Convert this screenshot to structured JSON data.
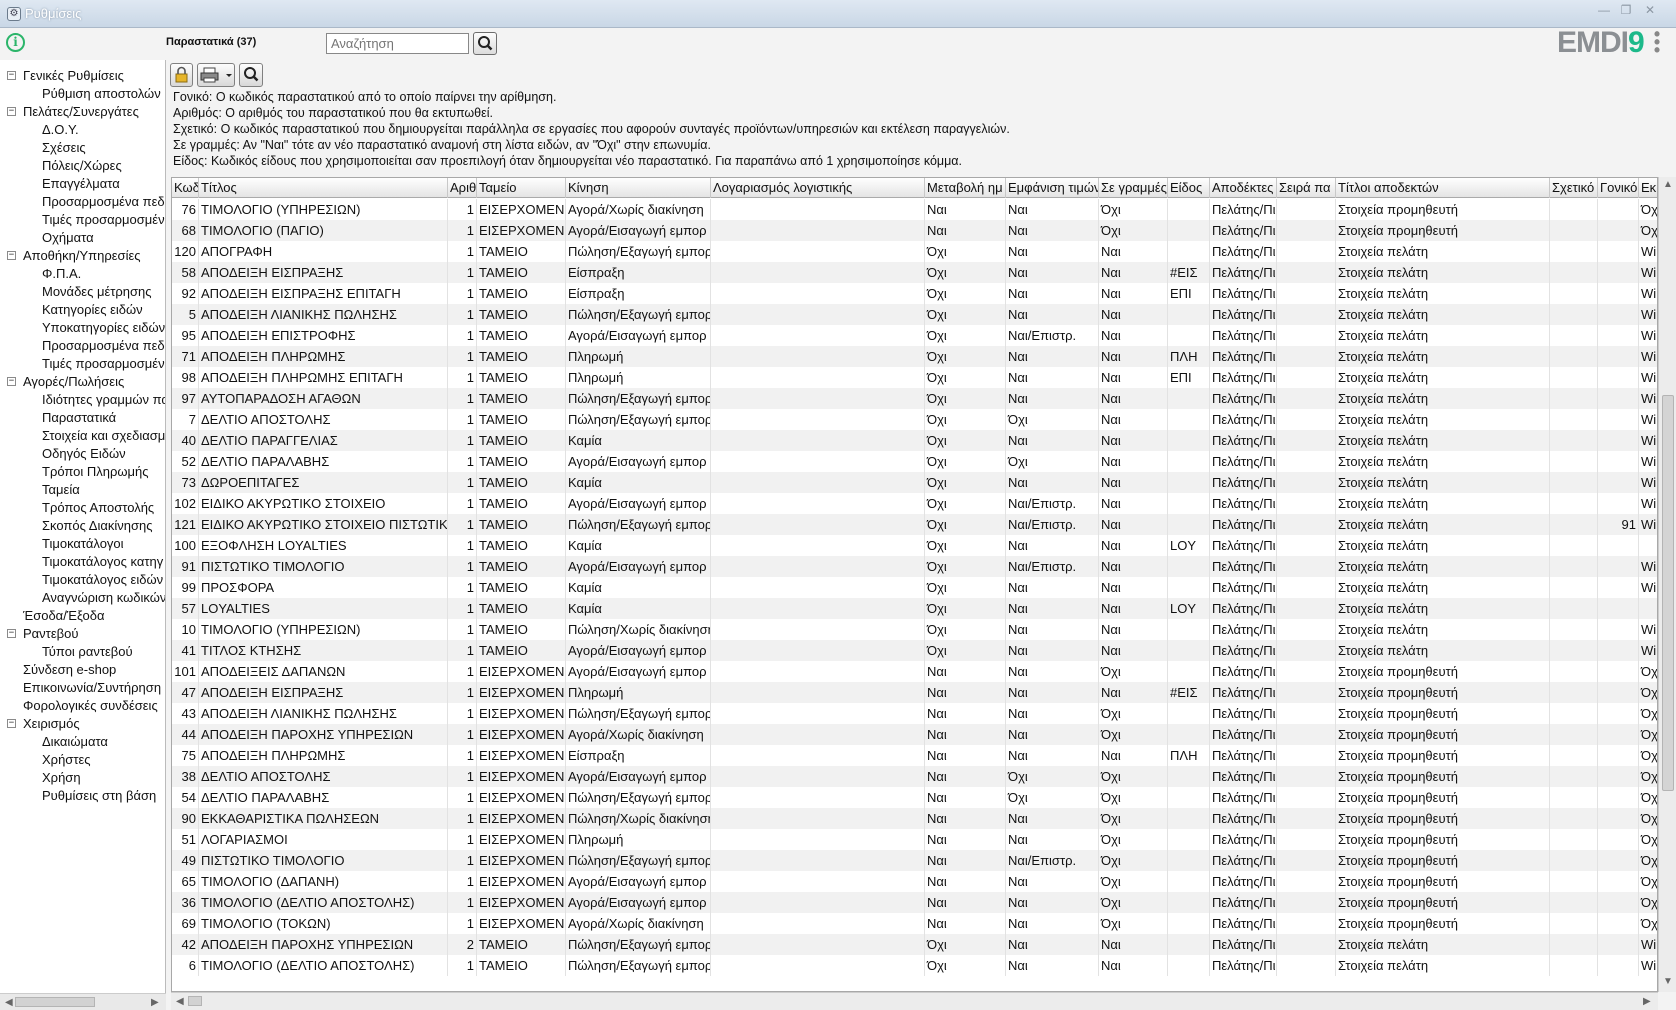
{
  "window": {
    "title": "Ρυθμίσεις"
  },
  "header": {
    "page_title": "Παραστατικά (37)",
    "search_placeholder": "Αναζήτηση",
    "logo_text": "EMDI",
    "logo_accent": "9"
  },
  "sidebar": {
    "items": [
      {
        "label": "Γενικές Ρυθμίσεις",
        "level": 0,
        "toggle": "−"
      },
      {
        "label": "Ρύθμιση αποστολών",
        "level": 1
      },
      {
        "label": "Πελάτες/Συνεργάτες",
        "level": 0,
        "toggle": "−"
      },
      {
        "label": "Δ.Ο.Υ.",
        "level": 1
      },
      {
        "label": "Σχέσεις",
        "level": 1
      },
      {
        "label": "Πόλεις/Χώρες",
        "level": 1
      },
      {
        "label": "Επαγγέλματα",
        "level": 1
      },
      {
        "label": "Προσαρμοσμένα πεδί",
        "level": 1
      },
      {
        "label": "Τιμές προσαρμοσμένω",
        "level": 1
      },
      {
        "label": "Οχήματα",
        "level": 1
      },
      {
        "label": "Αποθήκη/Υπηρεσίες",
        "level": 0,
        "toggle": "−"
      },
      {
        "label": "Φ.Π.Α.",
        "level": 1
      },
      {
        "label": "Μονάδες μέτρησης",
        "level": 1
      },
      {
        "label": "Κατηγορίες ειδών",
        "level": 1
      },
      {
        "label": "Υποκατηγορίες ειδών",
        "level": 1
      },
      {
        "label": "Προσαρμοσμένα πεδί",
        "level": 1
      },
      {
        "label": "Τιμές προσαρμοσμένι",
        "level": 1
      },
      {
        "label": "Αγορές/Πωλήσεις",
        "level": 0,
        "toggle": "−"
      },
      {
        "label": "Ιδιότητες γραμμών πα",
        "level": 1
      },
      {
        "label": "Παραστατικά",
        "level": 1
      },
      {
        "label": "Στοιχεία και σχεδιασμ",
        "level": 1
      },
      {
        "label": "Οδηγός Ειδών",
        "level": 1
      },
      {
        "label": "Τρόποι Πληρωμής",
        "level": 1
      },
      {
        "label": "Ταμεία",
        "level": 1
      },
      {
        "label": "Τρόπος Αποστολής",
        "level": 1
      },
      {
        "label": "Σκοπός Διακίνησης",
        "level": 1
      },
      {
        "label": "Τιμοκατάλογοι",
        "level": 1
      },
      {
        "label": "Τιμοκατάλογος κατηγ",
        "level": 1
      },
      {
        "label": "Τιμοκατάλογος ειδών",
        "level": 1
      },
      {
        "label": "Αναγνώριση κωδικών",
        "level": 1
      },
      {
        "label": "Έσοδα/Έξοδα",
        "level": 0
      },
      {
        "label": "Ραντεβού",
        "level": 0,
        "toggle": "−"
      },
      {
        "label": "Τύποι ραντεβού",
        "level": 1
      },
      {
        "label": "Σύνδεση e-shop",
        "level": 0
      },
      {
        "label": "Επικοινωνία/Συντήρηση",
        "level": 0
      },
      {
        "label": "Φορολογικές συνδέσεις",
        "level": 0
      },
      {
        "label": "Χειρισμός",
        "level": 0,
        "toggle": "−"
      },
      {
        "label": "Δικαιώματα",
        "level": 1
      },
      {
        "label": "Χρήστες",
        "level": 1
      },
      {
        "label": "Χρήση",
        "level": 1
      },
      {
        "label": "Ρυθμίσεις στη βάση",
        "level": 1
      }
    ]
  },
  "description": [
    "Γονικό: Ο κωδικός παραστατικού από το οποίο παίρνει την αρίθμηση.",
    "Αριθμός: Ο αριθμός του παραστατικού που θα εκτυπωθεί.",
    "Σχετικό: Ο κωδικός παραστατικού που δημιουργείται παράλληλα σε εργασίες που αφορούν συνταγές προϊόντων/υπηρεσιών και εκτέλεση παραγγελιών.",
    "Σε γραμμές: Αν \"Ναι\" τότε αν νέο παραστατικό αναμονή στη λίστα ειδών, αν \"Όχι\" στην επωνυμία.",
    "Είδος: Κωδικός είδους που χρησιμοποιείται σαν προεπιλογή όταν δημιουργείται νέο παραστατικό. Για παραπάνω από 1 χρησιμοποίησε κόμμα."
  ],
  "table": {
    "columns": [
      "Κωδ",
      "Τίτλος",
      "Αριθ",
      "Ταμείο",
      "Κίνηση",
      "Λογαριασμός λογιστικής",
      "Μεταβολή ημ",
      "Εμφάνιση τιμών",
      "Σε γραμμές",
      "Είδος",
      "Αποδέκτες",
      "Σειρά πα",
      "Τίτλοι αποδεκτών",
      "Σχετικό",
      "Γονικό",
      "Εκ"
    ],
    "rows": [
      [
        "76",
        "ΤΙΜΟΛΟΓΙΟ (ΥΠΗΡΕΣΙΩΝ)",
        "1",
        "ΕΙΣΕΡΧΟΜΕΝ.",
        "Αγορά/Χωρίς διακίνηση",
        "",
        "Ναι",
        "Ναι",
        "Όχι",
        "",
        "Πελάτης/Πι",
        "",
        "Στοιχεία προμηθευτή",
        "",
        "",
        "Όχ"
      ],
      [
        "68",
        "ΤΙΜΟΛΟΓΙΟ (ΠΑΓΙΟ)",
        "1",
        "ΕΙΣΕΡΧΟΜΕΝ.",
        "Αγορά/Εισαγωγή εμπορ",
        "",
        "Ναι",
        "Ναι",
        "Όχι",
        "",
        "Πελάτης/Πι",
        "",
        "Στοιχεία προμηθευτή",
        "",
        "",
        "Όχ"
      ],
      [
        "120",
        "ΑΠΟΓΡΑΦΗ",
        "1",
        "ΤΑΜΕΙΟ",
        "Πώληση/Εξαγωγή εμπορ",
        "",
        "Όχι",
        "Ναι",
        "Ναι",
        "",
        "Πελάτης/Πι",
        "",
        "Στοιχεία πελάτη",
        "",
        "",
        "Wi"
      ],
      [
        "58",
        "ΑΠΟΔΕΙΞΗ ΕΙΣΠΡΑΞΗΣ",
        "1",
        "ΤΑΜΕΙΟ",
        "Είσπραξη",
        "",
        "Όχι",
        "Ναι",
        "Ναι",
        "#ΕΙΣ",
        "Πελάτης/Πι",
        "",
        "Στοιχεία πελάτη",
        "",
        "",
        "Wi"
      ],
      [
        "92",
        "ΑΠΟΔΕΙΞΗ ΕΙΣΠΡΑΞΗΣ ΕΠΙΤΑΓΗ",
        "1",
        "ΤΑΜΕΙΟ",
        "Είσπραξη",
        "",
        "Όχι",
        "Ναι",
        "Ναι",
        "ΕΠΙ",
        "Πελάτης/Πι",
        "",
        "Στοιχεία πελάτη",
        "",
        "",
        "Wi"
      ],
      [
        "5",
        "ΑΠΟΔΕΙΞΗ ΛΙΑΝΙΚΗΣ ΠΩΛΗΣΗΣ",
        "1",
        "ΤΑΜΕΙΟ",
        "Πώληση/Εξαγωγή εμπορ",
        "",
        "Όχι",
        "Ναι",
        "Ναι",
        "",
        "Πελάτης/Πι",
        "",
        "Στοιχεία πελάτη",
        "",
        "",
        "Wi"
      ],
      [
        "95",
        "ΑΠΟΔΕΙΞΗ ΕΠΙΣΤΡΟΦΗΣ",
        "1",
        "ΤΑΜΕΙΟ",
        "Αγορά/Εισαγωγή εμπορ",
        "",
        "Όχι",
        "Ναι/Επιστρ.",
        "Ναι",
        "",
        "Πελάτης/Πι",
        "",
        "Στοιχεία πελάτη",
        "",
        "",
        "Wi"
      ],
      [
        "71",
        "ΑΠΟΔΕΙΞΗ ΠΛΗΡΩΜΗΣ",
        "1",
        "ΤΑΜΕΙΟ",
        "Πληρωμή",
        "",
        "Όχι",
        "Ναι",
        "Ναι",
        "ΠΛΗ",
        "Πελάτης/Πι",
        "",
        "Στοιχεία πελάτη",
        "",
        "",
        "Wi"
      ],
      [
        "98",
        "ΑΠΟΔΕΙΞΗ ΠΛΗΡΩΜΗΣ ΕΠΙΤΑΓΗ",
        "1",
        "ΤΑΜΕΙΟ",
        "Πληρωμή",
        "",
        "Όχι",
        "Ναι",
        "Ναι",
        "ΕΠΙ",
        "Πελάτης/Πι",
        "",
        "Στοιχεία πελάτη",
        "",
        "",
        "Wi"
      ],
      [
        "97",
        "ΑΥΤΟΠΑΡΑΔΟΣΗ ΑΓΑΘΩΝ",
        "1",
        "ΤΑΜΕΙΟ",
        "Πώληση/Εξαγωγή εμπορ",
        "",
        "Όχι",
        "Ναι",
        "Ναι",
        "",
        "Πελάτης/Πι",
        "",
        "Στοιχεία πελάτη",
        "",
        "",
        "Wi"
      ],
      [
        "7",
        "ΔΕΛΤΙΟ ΑΠΟΣΤΟΛΗΣ",
        "1",
        "ΤΑΜΕΙΟ",
        "Πώληση/Εξαγωγή εμπορ",
        "",
        "Όχι",
        "Όχι",
        "Ναι",
        "",
        "Πελάτης/Πι",
        "",
        "Στοιχεία πελάτη",
        "",
        "",
        "Wi"
      ],
      [
        "40",
        "ΔΕΛΤΙΟ ΠΑΡΑΓΓΕΛΙΑΣ",
        "1",
        "ΤΑΜΕΙΟ",
        "Καμία",
        "",
        "Όχι",
        "Ναι",
        "Ναι",
        "",
        "Πελάτης/Πι",
        "",
        "Στοιχεία πελάτη",
        "",
        "",
        "Wi"
      ],
      [
        "52",
        "ΔΕΛΤΙΟ ΠΑΡΑΛΑΒΗΣ",
        "1",
        "ΤΑΜΕΙΟ",
        "Αγορά/Εισαγωγή εμπορ",
        "",
        "Όχι",
        "Όχι",
        "Ναι",
        "",
        "Πελάτης/Πι",
        "",
        "Στοιχεία πελάτη",
        "",
        "",
        "Wi"
      ],
      [
        "73",
        "ΔΩΡΟΕΠΙΤΑΓΕΣ",
        "1",
        "ΤΑΜΕΙΟ",
        "Καμία",
        "",
        "Όχι",
        "Ναι",
        "Ναι",
        "",
        "Πελάτης/Πι",
        "",
        "Στοιχεία πελάτη",
        "",
        "",
        "Wi"
      ],
      [
        "102",
        "ΕΙΔΙΚΟ ΑΚΥΡΩΤΙΚΟ ΣΤΟΙΧΕΙΟ",
        "1",
        "ΤΑΜΕΙΟ",
        "Αγορά/Εισαγωγή εμπορ",
        "",
        "Όχι",
        "Ναι/Επιστρ.",
        "Ναι",
        "",
        "Πελάτης/Πι",
        "",
        "Στοιχεία πελάτη",
        "",
        "",
        "Wi"
      ],
      [
        "121",
        "ΕΙΔΙΚΟ ΑΚΥΡΩΤΙΚΟ ΣΤΟΙΧΕΙΟ ΠΙΣΤΩΤΙΚ",
        "1",
        "ΤΑΜΕΙΟ",
        "Πώληση/Εξαγωγή εμπορ",
        "",
        "Όχι",
        "Ναι/Επιστρ.",
        "Ναι",
        "",
        "Πελάτης/Πι",
        "",
        "Στοιχεία πελάτη",
        "",
        "91",
        "Wi"
      ],
      [
        "100",
        "ΕΞΟΦΛΗΣΗ LOYALTIES",
        "1",
        "ΤΑΜΕΙΟ",
        "Καμία",
        "",
        "Όχι",
        "Ναι",
        "Ναι",
        "LOY",
        "Πελάτης/Πι",
        "",
        "Στοιχεία πελάτη",
        "",
        "",
        ""
      ],
      [
        "91",
        "ΠΙΣΤΩΤΙΚΟ ΤΙΜΟΛΟΓΙΟ",
        "1",
        "ΤΑΜΕΙΟ",
        "Αγορά/Εισαγωγή εμπορ",
        "",
        "Όχι",
        "Ναι/Επιστρ.",
        "Ναι",
        "",
        "Πελάτης/Πι",
        "",
        "Στοιχεία πελάτη",
        "",
        "",
        "Wi"
      ],
      [
        "99",
        "ΠΡΟΣΦΟΡΑ",
        "1",
        "ΤΑΜΕΙΟ",
        "Καμία",
        "",
        "Όχι",
        "Ναι",
        "Ναι",
        "",
        "Πελάτης/Πι",
        "",
        "Στοιχεία πελάτη",
        "",
        "",
        "Wi"
      ],
      [
        "57",
        "LOYALTIES",
        "1",
        "ΤΑΜΕΙΟ",
        "Καμία",
        "",
        "Όχι",
        "Ναι",
        "Ναι",
        "LOY",
        "Πελάτης/Πι",
        "",
        "Στοιχεία πελάτη",
        "",
        "",
        ""
      ],
      [
        "10",
        "ΤΙΜΟΛΟΓΙΟ (ΥΠΗΡΕΣΙΩΝ)",
        "1",
        "ΤΑΜΕΙΟ",
        "Πώληση/Χωρίς διακίνηση",
        "",
        "Όχι",
        "Ναι",
        "Ναι",
        "",
        "Πελάτης/Πι",
        "",
        "Στοιχεία πελάτη",
        "",
        "",
        "Wi"
      ],
      [
        "41",
        "ΤΙΤΛΟΣ ΚΤΗΣΗΣ",
        "1",
        "ΤΑΜΕΙΟ",
        "Αγορά/Εισαγωγή εμπορ",
        "",
        "Όχι",
        "Ναι",
        "Ναι",
        "",
        "Πελάτης/Πι",
        "",
        "Στοιχεία πελάτη",
        "",
        "",
        "Wi"
      ],
      [
        "101",
        "ΑΠΟΔΕΙΞΕΙΣ ΔΑΠΑΝΩΝ",
        "1",
        "ΕΙΣΕΡΧΟΜΕΝ.",
        "Αγορά/Εισαγωγή εμπορ",
        "",
        "Ναι",
        "Ναι",
        "Όχι",
        "",
        "Πελάτης/Πι",
        "",
        "Στοιχεία προμηθευτή",
        "",
        "",
        "Όχ"
      ],
      [
        "47",
        "ΑΠΟΔΕΙΞΗ ΕΙΣΠΡΑΞΗΣ",
        "1",
        "ΕΙΣΕΡΧΟΜΕΝ.",
        "Πληρωμή",
        "",
        "Ναι",
        "Ναι",
        "Ναι",
        "#ΕΙΣ",
        "Πελάτης/Πι",
        "",
        "Στοιχεία προμηθευτή",
        "",
        "",
        "Όχ"
      ],
      [
        "43",
        "ΑΠΟΔΕΙΞΗ ΛΙΑΝΙΚΗΣ ΠΩΛΗΣΗΣ",
        "1",
        "ΕΙΣΕΡΧΟΜΕΝ.",
        "Πώληση/Εξαγωγή εμπορ",
        "",
        "Ναι",
        "Ναι",
        "Όχι",
        "",
        "Πελάτης/Πι",
        "",
        "Στοιχεία προμηθευτή",
        "",
        "",
        "Όχ"
      ],
      [
        "44",
        "ΑΠΟΔΕΙΞΗ ΠΑΡΟΧΗΣ ΥΠΗΡΕΣΙΩΝ",
        "1",
        "ΕΙΣΕΡΧΟΜΕΝ.",
        "Αγορά/Χωρίς διακίνηση",
        "",
        "Ναι",
        "Ναι",
        "Όχι",
        "",
        "Πελάτης/Πι",
        "",
        "Στοιχεία προμηθευτή",
        "",
        "",
        "Όχ"
      ],
      [
        "75",
        "ΑΠΟΔΕΙΞΗ ΠΛΗΡΩΜΗΣ",
        "1",
        "ΕΙΣΕΡΧΟΜΕΝ.",
        "Είσπραξη",
        "",
        "Ναι",
        "Ναι",
        "Ναι",
        "ΠΛΗ",
        "Πελάτης/Πι",
        "",
        "Στοιχεία προμηθευτή",
        "",
        "",
        "Όχ"
      ],
      [
        "38",
        "ΔΕΛΤΙΟ ΑΠΟΣΤΟΛΗΣ",
        "1",
        "ΕΙΣΕΡΧΟΜΕΝ.",
        "Αγορά/Εισαγωγή εμπορ",
        "",
        "Ναι",
        "Όχι",
        "Όχι",
        "",
        "Πελάτης/Πι",
        "",
        "Στοιχεία προμηθευτή",
        "",
        "",
        "Όχ"
      ],
      [
        "54",
        "ΔΕΛΤΙΟ ΠΑΡΑΛΑΒΗΣ",
        "1",
        "ΕΙΣΕΡΧΟΜΕΝ.",
        "Πώληση/Εξαγωγή εμπορ",
        "",
        "Ναι",
        "Όχι",
        "Όχι",
        "",
        "Πελάτης/Πι",
        "",
        "Στοιχεία προμηθευτή",
        "",
        "",
        "Όχ"
      ],
      [
        "90",
        "ΕΚΚΑΘΑΡΙΣΤΙΚΑ ΠΩΛΗΣΕΩΝ",
        "1",
        "ΕΙΣΕΡΧΟΜΕΝ.",
        "Πώληση/Χωρίς διακίνηση",
        "",
        "Ναι",
        "Ναι",
        "Όχι",
        "",
        "Πελάτης/Πι",
        "",
        "Στοιχεία προμηθευτή",
        "",
        "",
        "Όχ"
      ],
      [
        "51",
        "ΛΟΓΑΡΙΑΣΜΟΙ",
        "1",
        "ΕΙΣΕΡΧΟΜΕΝ.",
        "Πληρωμή",
        "",
        "Ναι",
        "Ναι",
        "Όχι",
        "",
        "Πελάτης/Πι",
        "",
        "Στοιχεία προμηθευτή",
        "",
        "",
        "Όχ"
      ],
      [
        "49",
        "ΠΙΣΤΩΤΙΚΟ ΤΙΜΟΛΟΓΙΟ",
        "1",
        "ΕΙΣΕΡΧΟΜΕΝ.",
        "Πώληση/Εξαγωγή εμπορ",
        "",
        "Ναι",
        "Ναι/Επιστρ.",
        "Όχι",
        "",
        "Πελάτης/Πι",
        "",
        "Στοιχεία προμηθευτή",
        "",
        "",
        "Όχ"
      ],
      [
        "65",
        "ΤΙΜΟΛΟΓΙΟ (ΔΑΠΑΝΗ)",
        "1",
        "ΕΙΣΕΡΧΟΜΕΝ.",
        "Αγορά/Εισαγωγή εμπορ",
        "",
        "Ναι",
        "Ναι",
        "Όχι",
        "",
        "Πελάτης/Πι",
        "",
        "Στοιχεία προμηθευτή",
        "",
        "",
        "Όχ"
      ],
      [
        "36",
        "ΤΙΜΟΛΟΓΙΟ (ΔΕΛΤΙΟ ΑΠΟΣΤΟΛΗΣ)",
        "1",
        "ΕΙΣΕΡΧΟΜΕΝ.",
        "Αγορά/Εισαγωγή εμπορ",
        "",
        "Ναι",
        "Ναι",
        "Όχι",
        "",
        "Πελάτης/Πι",
        "",
        "Στοιχεία προμηθευτή",
        "",
        "",
        "Όχ"
      ],
      [
        "69",
        "ΤΙΜΟΛΟΓΙΟ (ΤΟΚΩΝ)",
        "1",
        "ΕΙΣΕΡΧΟΜΕΝ.",
        "Αγορά/Χωρίς διακίνηση",
        "",
        "Ναι",
        "Ναι",
        "Όχι",
        "",
        "Πελάτης/Πι",
        "",
        "Στοιχεία προμηθευτή",
        "",
        "",
        "Όχ"
      ],
      [
        "42",
        "ΑΠΟΔΕΙΞΗ ΠΑΡΟΧΗΣ ΥΠΗΡΕΣΙΩΝ",
        "2",
        "ΤΑΜΕΙΟ",
        "Πώληση/Εξαγωγή εμπορ",
        "",
        "Όχι",
        "Ναι",
        "Ναι",
        "",
        "Πελάτης/Πι",
        "",
        "Στοιχεία πελάτη",
        "",
        "",
        "Wi"
      ],
      [
        "6",
        "ΤΙΜΟΛΟΓΙΟ (ΔΕΛΤΙΟ ΑΠΟΣΤΟΛΗΣ)",
        "1",
        "ΤΑΜΕΙΟ",
        "Πώληση/Εξαγωγή εμπορ",
        "",
        "Όχι",
        "Ναι",
        "Ναι",
        "",
        "Πελάτης/Πι",
        "",
        "Στοιχεία πελάτη",
        "",
        "",
        "Wi"
      ]
    ]
  }
}
